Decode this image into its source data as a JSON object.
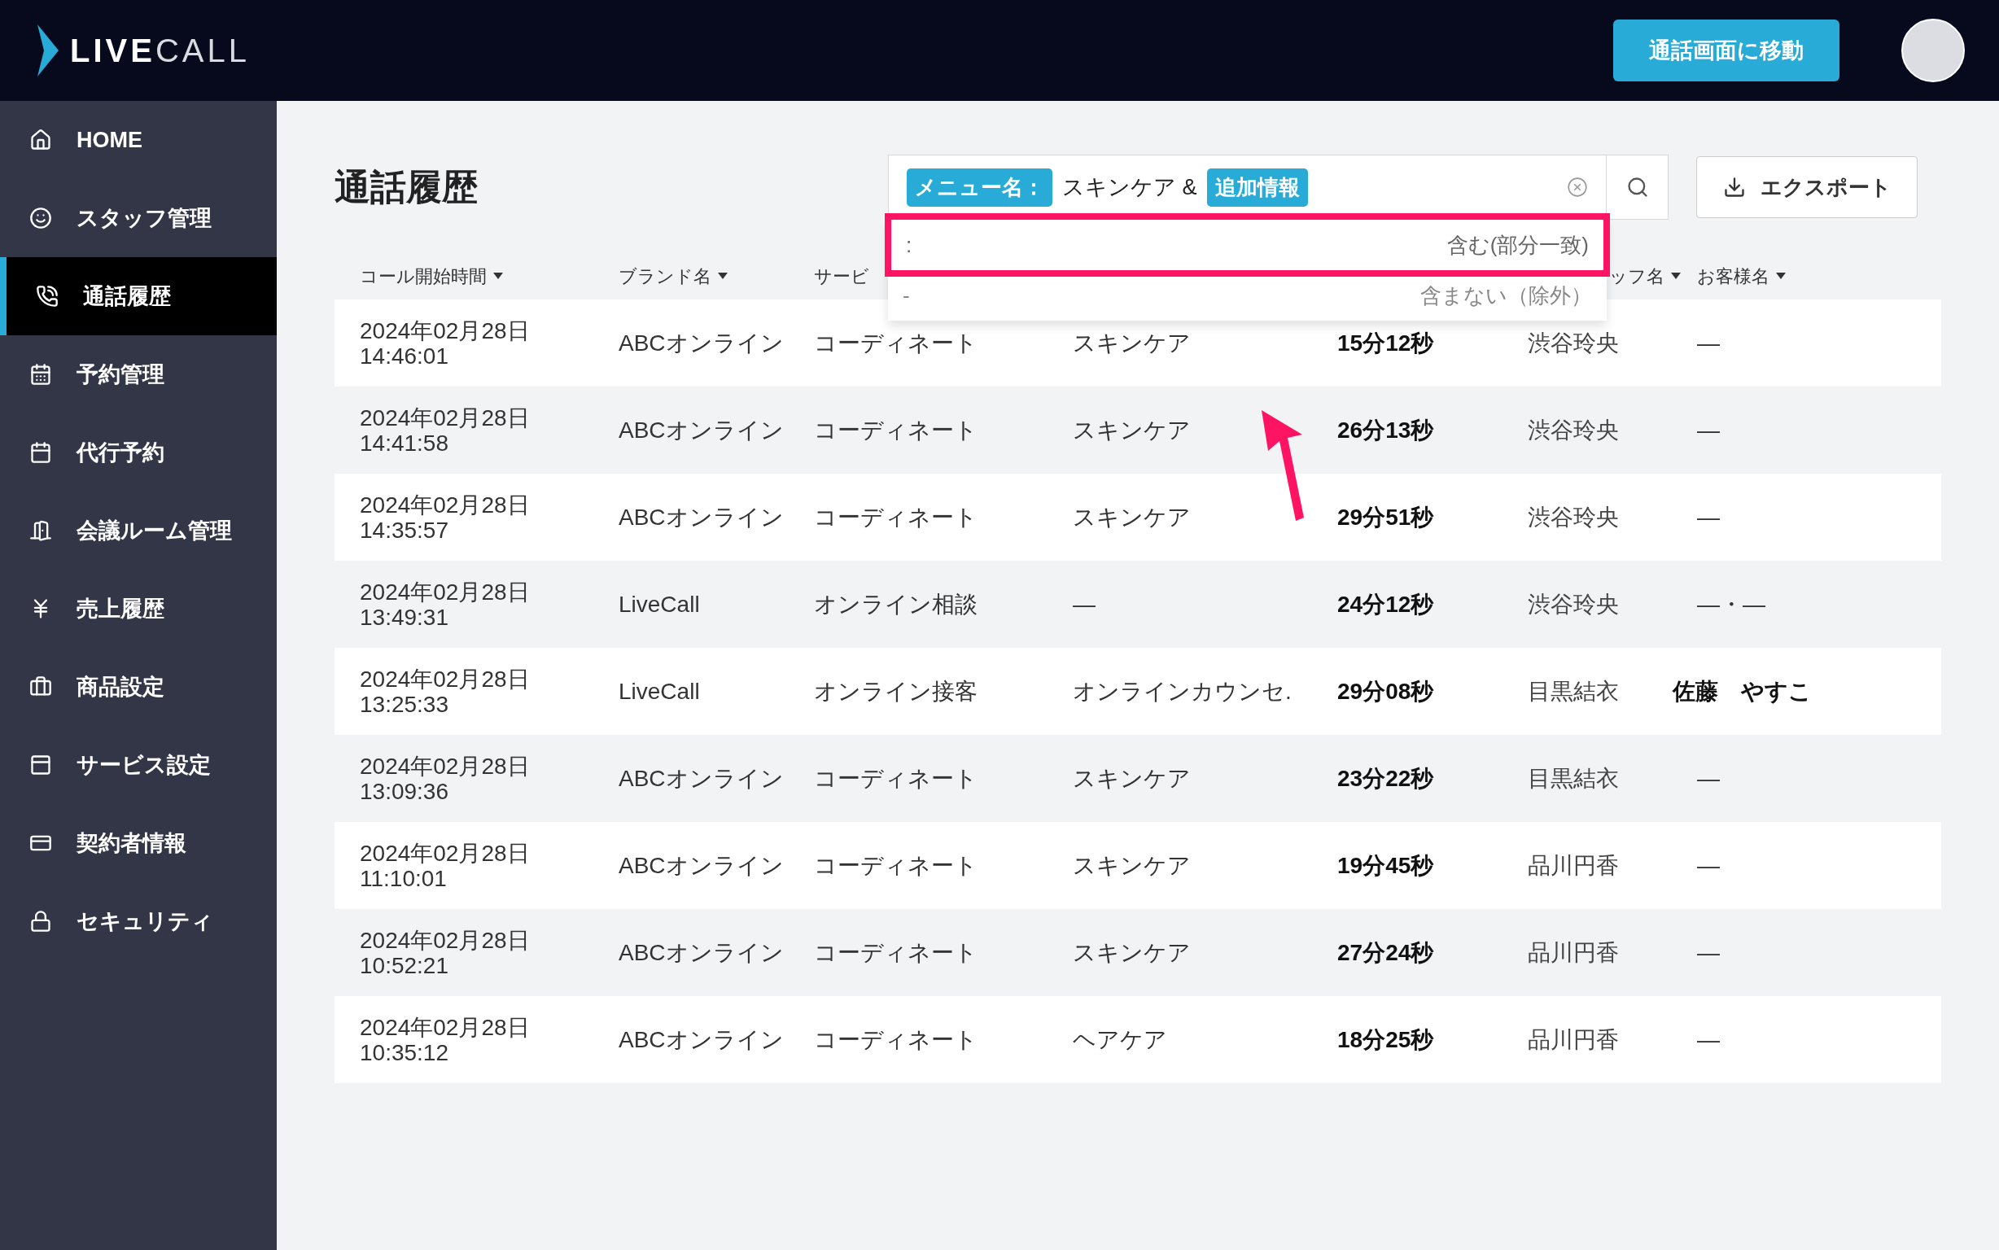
{
  "logo": {
    "strong": "LIVE",
    "light": "CALL"
  },
  "header": {
    "call_button": "通話画面に移動"
  },
  "sidebar": {
    "items": [
      {
        "label": "HOME",
        "selected": false
      },
      {
        "label": "スタッフ管理",
        "selected": false
      },
      {
        "label": "通話履歴",
        "selected": true
      },
      {
        "label": "予約管理",
        "selected": false
      },
      {
        "label": "代行予約",
        "selected": false
      },
      {
        "label": "会議ルーム管理",
        "selected": false
      },
      {
        "label": "売上履歴",
        "selected": false
      },
      {
        "label": "商品設定",
        "selected": false
      },
      {
        "label": "サービス設定",
        "selected": false
      },
      {
        "label": "契約者情報",
        "selected": false
      },
      {
        "label": "セキュリティ",
        "selected": false
      }
    ]
  },
  "page_title": "通話履歴",
  "search": {
    "chip_1": "メニュー名：",
    "text": "スキンケア &",
    "chip_2": "追加情報"
  },
  "dropdown": {
    "options": [
      {
        "key": ":",
        "label": "含む(部分一致)",
        "highlighted": true
      },
      {
        "key": "-",
        "label": "含まない（除外）",
        "highlighted": false
      }
    ]
  },
  "export_button": "エクスポート",
  "table": {
    "columns": [
      {
        "label": "コール開始時間",
        "sort": true
      },
      {
        "label": "ブランド名",
        "sort": true
      },
      {
        "label": "サービ",
        "sort": false
      },
      {
        "label": "ッフ名",
        "sort": true
      },
      {
        "label": "お客様名",
        "sort": true
      }
    ],
    "rows": [
      {
        "date": "2024年02月28日",
        "time": "14:46:01",
        "brand": "ABCオンライン",
        "service": "コーディネート",
        "menu": "スキンケア",
        "duration": "15分12秒",
        "staff": "渋谷玲央",
        "customer": "—",
        "customer_bold": false
      },
      {
        "date": "2024年02月28日",
        "time": "14:41:58",
        "brand": "ABCオンライン",
        "service": "コーディネート",
        "menu": "スキンケア",
        "duration": "26分13秒",
        "staff": "渋谷玲央",
        "customer": "—",
        "customer_bold": false
      },
      {
        "date": "2024年02月28日",
        "time": "14:35:57",
        "brand": "ABCオンライン",
        "service": "コーディネート",
        "menu": "スキンケア",
        "duration": "29分51秒",
        "staff": "渋谷玲央",
        "customer": "—",
        "customer_bold": false
      },
      {
        "date": "2024年02月28日",
        "time": "13:49:31",
        "brand": "LiveCall",
        "service": "オンライン相談",
        "menu": "—",
        "duration": "24分12秒",
        "staff": "渋谷玲央",
        "customer": "—・—",
        "customer_bold": false
      },
      {
        "date": "2024年02月28日",
        "time": "13:25:33",
        "brand": "LiveCall",
        "service": "オンライン接客",
        "menu": "オンラインカウンセ.",
        "duration": "29分08秒",
        "staff": "目黒結衣",
        "customer": "佐藤　やすこ",
        "customer_bold": true
      },
      {
        "date": "2024年02月28日",
        "time": "13:09:36",
        "brand": "ABCオンライン",
        "service": "コーディネート",
        "menu": "スキンケア",
        "duration": "23分22秒",
        "staff": "目黒結衣",
        "customer": "—",
        "customer_bold": false
      },
      {
        "date": "2024年02月28日",
        "time": "11:10:01",
        "brand": "ABCオンライン",
        "service": "コーディネート",
        "menu": "スキンケア",
        "duration": "19分45秒",
        "staff": "品川円香",
        "customer": "—",
        "customer_bold": false
      },
      {
        "date": "2024年02月28日",
        "time": "10:52:21",
        "brand": "ABCオンライン",
        "service": "コーディネート",
        "menu": "スキンケア",
        "duration": "27分24秒",
        "staff": "品川円香",
        "customer": "—",
        "customer_bold": false
      },
      {
        "date": "2024年02月28日",
        "time": "10:35:12",
        "brand": "ABCオンライン",
        "service": "コーディネート",
        "menu": "ヘアケア",
        "duration": "18分25秒",
        "staff": "品川円香",
        "customer": "—",
        "customer_bold": false
      }
    ]
  }
}
